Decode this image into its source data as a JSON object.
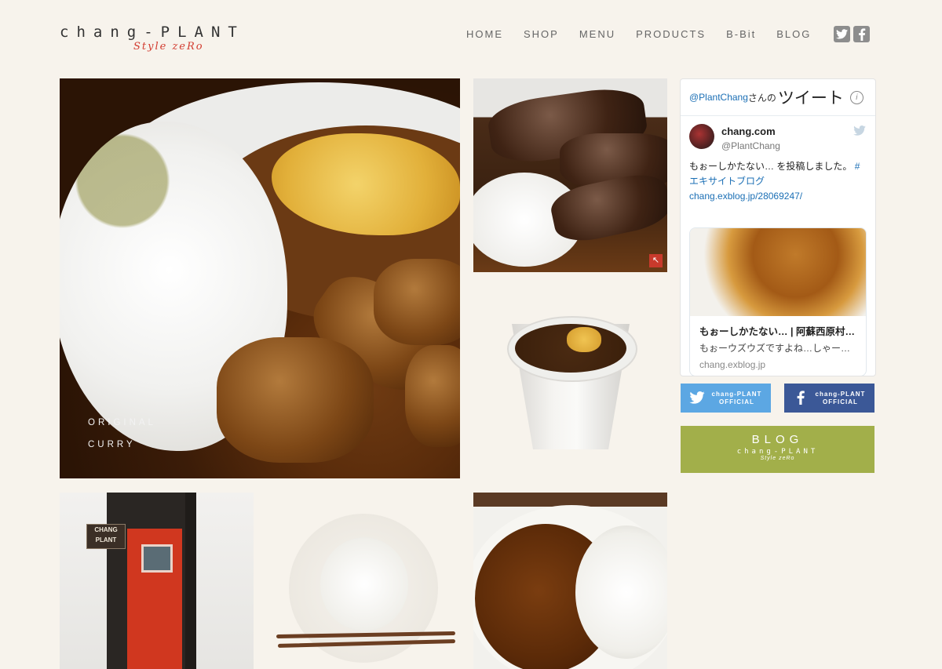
{
  "header": {
    "logo_main": "chang-PLANT",
    "logo_sub": "Style zeRo",
    "nav": [
      "HOME",
      "SHOP",
      "MENU",
      "PRODUCTS",
      "B-Bit",
      "BLOG"
    ],
    "social_icons": [
      "twitter-icon",
      "facebook-icon"
    ]
  },
  "hero": {
    "caption_line1": "ORIGINAL",
    "caption_line2": "CURRY"
  },
  "store_sign": "CHANG PLANT",
  "twitter_widget": {
    "handle_link": "@PlantChang",
    "handle_suffix": "さんの",
    "title": "ツイート",
    "tweet": {
      "name": "chang.com",
      "username": "@PlantChang",
      "text_prefix": "もぉーしかたない… を投稿しました。",
      "hashtag": "#エキサイトブログ",
      "url": "chang.exblog.jp/28069247/"
    },
    "card": {
      "title": "もぉーしかたない… | 阿蘇西原村…",
      "description": "もぉーウズウズですよね…しゃー…",
      "domain": "chang.exblog.jp"
    }
  },
  "side_buttons": {
    "twitter_line1": "chang-PLANT",
    "twitter_line2": "OFFICIAL",
    "facebook_line1": "chang-PLANT",
    "facebook_line2": "OFFICIAL",
    "blog_title": "BLOG",
    "blog_sub": "chang-PLANT",
    "blog_sub2": "Style zeRo"
  },
  "colors": {
    "background": "#f7f3ec",
    "accent_red": "#d23b2f",
    "twitter_blue": "#5ca7e3",
    "facebook_blue": "#3b5897",
    "blog_green": "#a2af4a"
  }
}
